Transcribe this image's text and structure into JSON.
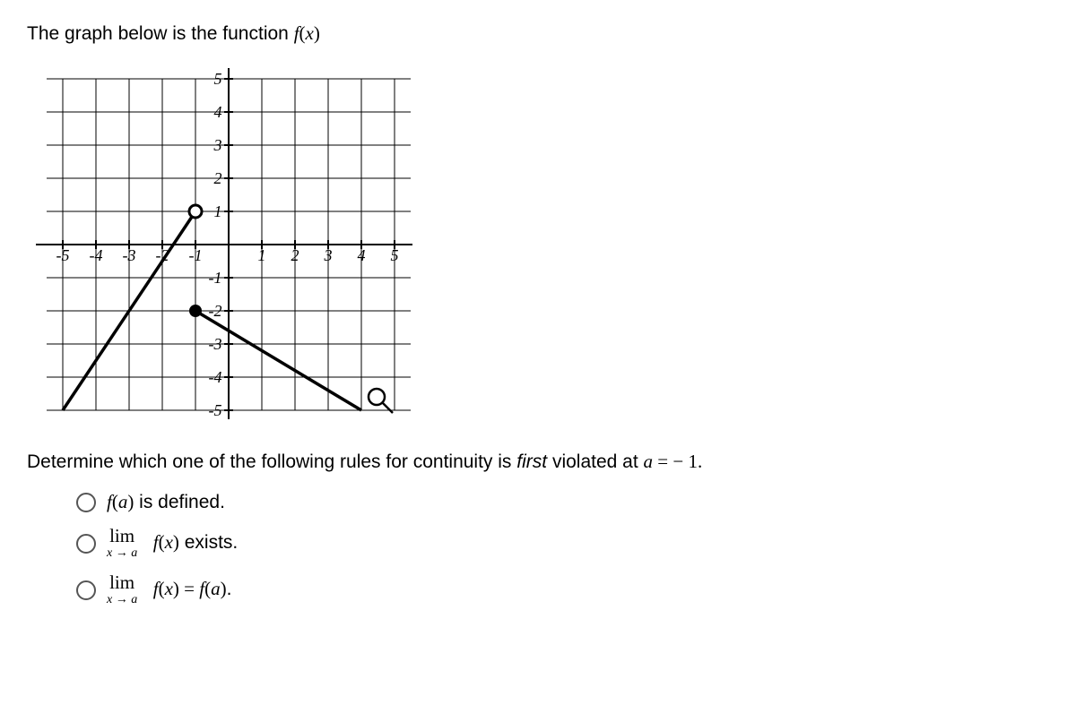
{
  "prompt": {
    "prefix": "The graph below is the function ",
    "func": "f",
    "arg": "x"
  },
  "chart_data": {
    "type": "line",
    "x_ticks": [
      -5,
      -4,
      -3,
      -2,
      -1,
      1,
      2,
      3,
      4,
      5
    ],
    "y_ticks": [
      -5,
      -4,
      -3,
      -2,
      -1,
      1,
      2,
      3,
      4,
      5
    ],
    "xlim": [
      -5.5,
      5.5
    ],
    "ylim": [
      -5.5,
      5.5
    ],
    "series": [
      {
        "name": "left-branch",
        "points": [
          [
            -5,
            -5
          ],
          [
            -1,
            1
          ]
        ],
        "open_end": {
          "x": -1,
          "y": 1
        }
      },
      {
        "name": "right-branch",
        "points": [
          [
            -1,
            -2
          ],
          [
            4,
            -5
          ]
        ],
        "closed_start": {
          "x": -1,
          "y": -2
        }
      }
    ]
  },
  "question": {
    "prefix": "Determine which one of the following rules for continuity is ",
    "emph": "first",
    "mid": " violated at ",
    "var": "a",
    "eq": " = ",
    "val_prefix": " − ",
    "val": "1."
  },
  "options": {
    "o1": {
      "f": "f",
      "a": "a",
      "tail": " is defined."
    },
    "o2": {
      "lim": "lim",
      "sub_l": "x",
      "arrow": "→",
      "sub_r": "a",
      "f": "f",
      "x": "x",
      "tail": " exists."
    },
    "o3": {
      "lim": "lim",
      "sub_l": "x",
      "arrow": "→",
      "sub_r": "a",
      "f": "f",
      "x": "x",
      "eq": " = ",
      "f2": "f",
      "a": "a",
      "tail": "."
    }
  }
}
